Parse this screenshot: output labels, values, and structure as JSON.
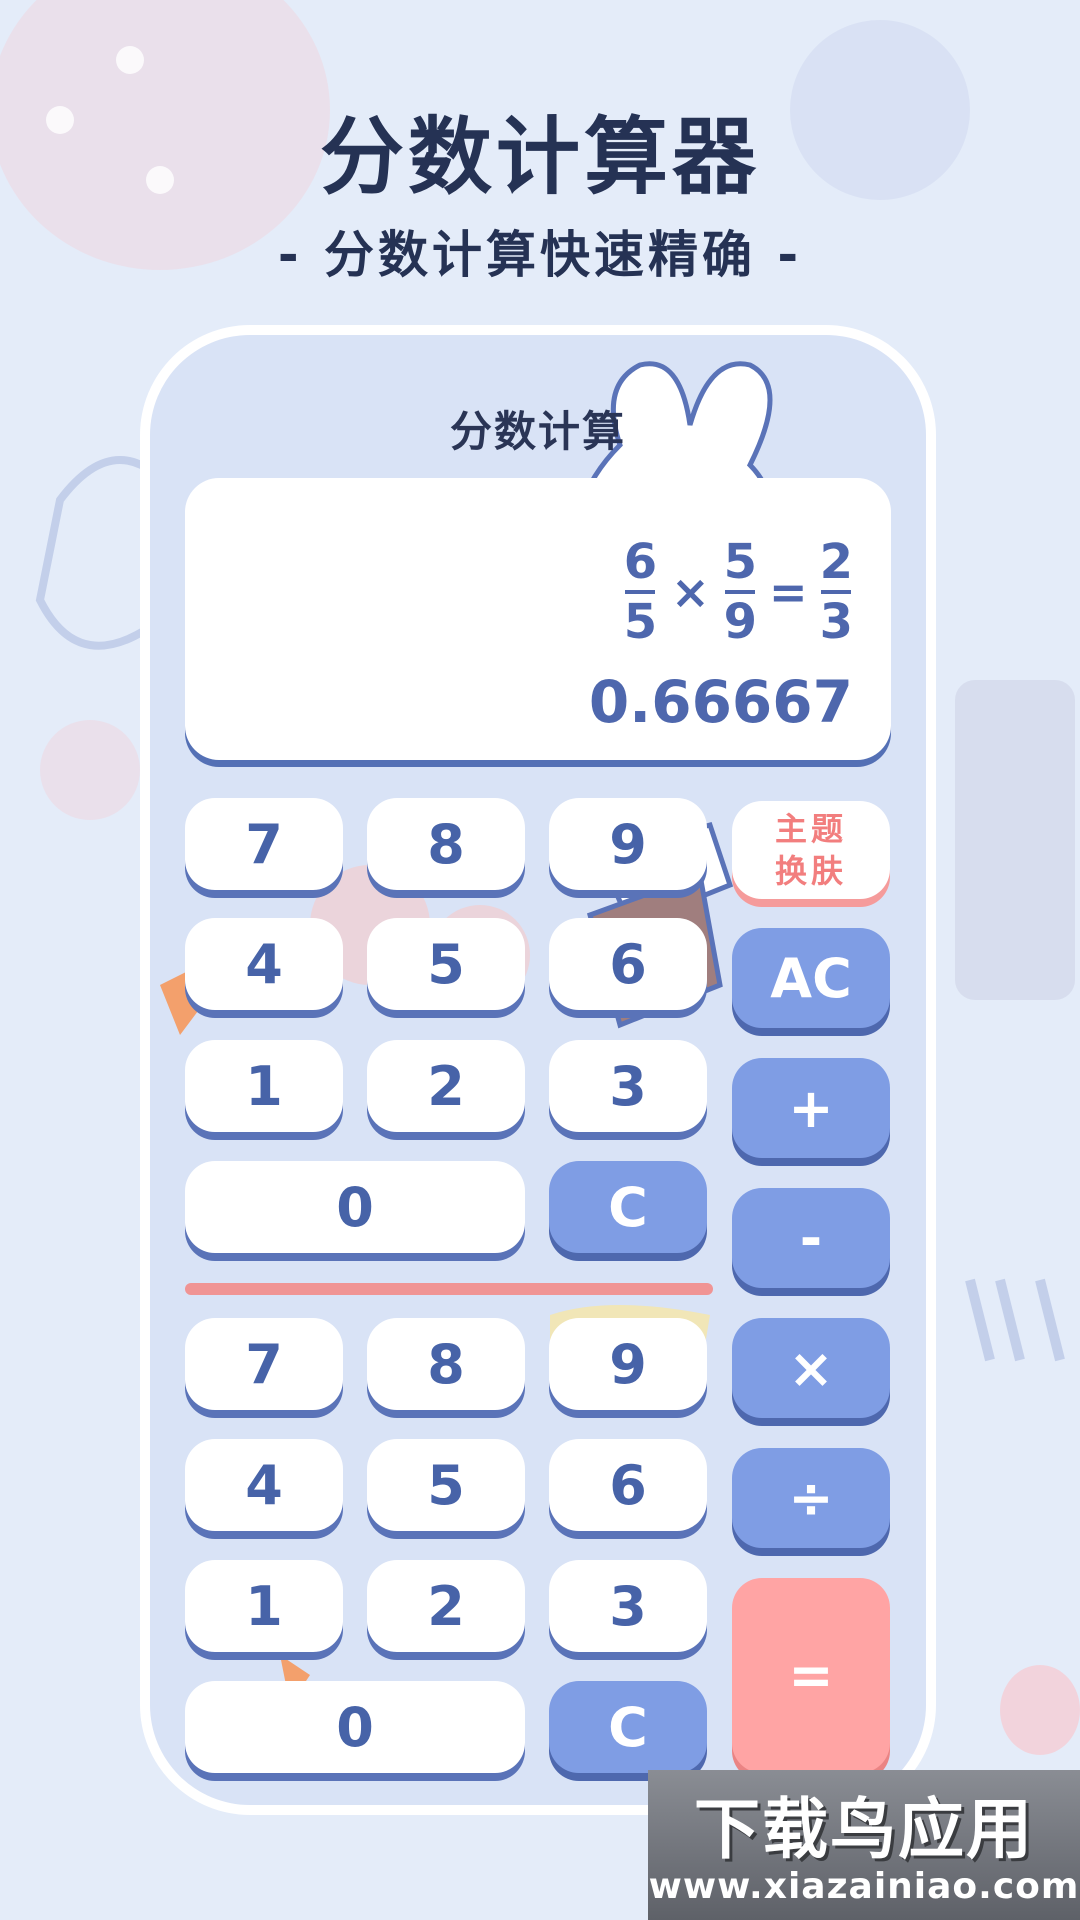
{
  "hero": {
    "title": "分数计算器",
    "subtitle": "- 分数计算快速精确 -"
  },
  "screen": {
    "title": "分数计算"
  },
  "display": {
    "operand1": {
      "numerator": "6",
      "denominator": "5"
    },
    "operator": "×",
    "operand2": {
      "numerator": "5",
      "denominator": "9"
    },
    "equals": "=",
    "answer": {
      "numerator": "2",
      "denominator": "3"
    },
    "decimal": "0.66667"
  },
  "keypad_top": {
    "keys": [
      "7",
      "8",
      "9",
      "4",
      "5",
      "6",
      "1",
      "2",
      "3",
      "0",
      "C"
    ]
  },
  "keypad_bottom": {
    "keys": [
      "7",
      "8",
      "9",
      "4",
      "5",
      "6",
      "1",
      "2",
      "3",
      "0",
      "C"
    ]
  },
  "side_keys": {
    "theme_line1": "主题",
    "theme_line2": "换肤",
    "clear_all": "AC",
    "plus": "+",
    "minus": "-",
    "multiply": "×",
    "divide": "÷",
    "equals": "="
  },
  "watermark": {
    "main": "下载鸟应用",
    "url": "www.xiazainiao.com"
  },
  "colors": {
    "background": "#e4ecf9",
    "title": "#253254",
    "accent_blue": "#7f9de4",
    "accent_pink": "#ffa4a4",
    "key_text": "#4763a8"
  }
}
